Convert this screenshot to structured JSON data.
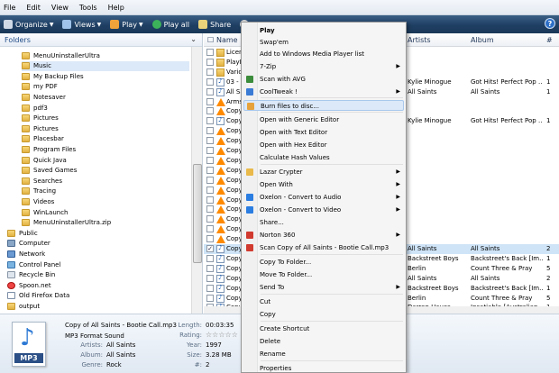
{
  "menubar": [
    "File",
    "Edit",
    "View",
    "Tools",
    "Help"
  ],
  "toolbar": {
    "organize": "Organize",
    "views": "Views",
    "play": "Play",
    "play_all": "Play all",
    "share": "Share",
    "burn": "Bu"
  },
  "folders": {
    "header": "Folders",
    "items": [
      "MenuUninstallerUltra",
      "Music",
      "My Backup Files",
      "my PDF",
      "Notesaver",
      "pdf3",
      "Pictures",
      "Pictures",
      "Placesbar",
      "Program Files",
      "Quick Java",
      "Saved Games",
      "Searches",
      "Tracing",
      "Videos",
      "WinLaunch",
      "MenuUninstallerUltra.zip",
      "Public",
      "Computer",
      "Network",
      "Control Panel",
      "Recycle Bin",
      "Spoon.net",
      "Old Firefox Data",
      "output"
    ]
  },
  "list": {
    "columns": {
      "name": "Name",
      "artists": "Artists",
      "album": "Album",
      "track": "#"
    },
    "rows": [
      {
        "name": "Licen",
        "artists": "",
        "album": "",
        "track": ""
      },
      {
        "name": "PlayL",
        "artists": "",
        "album": "",
        "track": ""
      },
      {
        "name": "Vario",
        "artists": "",
        "album": "",
        "track": ""
      },
      {
        "name": "03 -",
        "artists": "Kylie Minogue",
        "album": "Got Hits! Perfect Pop ...",
        "track": "1"
      },
      {
        "name": "All Sa",
        "artists": "All Saints",
        "album": "All Saints",
        "track": "1"
      },
      {
        "name": "Arms",
        "artists": "",
        "album": "",
        "track": ""
      },
      {
        "name": "Copy",
        "artists": "",
        "album": "",
        "track": ""
      },
      {
        "name": "Copy",
        "artists": "Kylie Minogue",
        "album": "Got Hits! Perfect Pop ...",
        "track": "1"
      },
      {
        "name": "Copy",
        "artists": "",
        "album": "",
        "track": ""
      },
      {
        "name": "Copy",
        "artists": "",
        "album": "",
        "track": ""
      },
      {
        "name": "Copy",
        "artists": "",
        "album": "",
        "track": ""
      },
      {
        "name": "Copy",
        "artists": "",
        "album": "",
        "track": ""
      },
      {
        "name": "Copy",
        "artists": "",
        "album": "",
        "track": ""
      },
      {
        "name": "Copy",
        "artists": "",
        "album": "",
        "track": ""
      },
      {
        "name": "Copy",
        "artists": "",
        "album": "",
        "track": ""
      },
      {
        "name": "Copy",
        "artists": "",
        "album": "",
        "track": ""
      },
      {
        "name": "Copy",
        "artists": "",
        "album": "",
        "track": ""
      },
      {
        "name": "Copy",
        "artists": "",
        "album": "",
        "track": ""
      },
      {
        "name": "Copy",
        "artists": "",
        "album": "",
        "track": ""
      },
      {
        "name": "Copy",
        "artists": "",
        "album": "",
        "track": ""
      },
      {
        "name": "Copy",
        "artists": "All Saints",
        "album": "All Saints",
        "track": "2"
      },
      {
        "name": "Copy",
        "artists": "Backstreet Boys",
        "album": "Backstreet's Back [Im...",
        "track": "1"
      },
      {
        "name": "Copy",
        "artists": "Berlin",
        "album": "Count Three & Pray",
        "track": "5"
      },
      {
        "name": "Copy",
        "artists": "All Saints",
        "album": "All Saints",
        "track": "2"
      },
      {
        "name": "Copy",
        "artists": "Backstreet Boys",
        "album": "Backstreet's Back [Im...",
        "track": "1"
      },
      {
        "name": "Copy",
        "artists": "Berlin",
        "album": "Count Three & Pray",
        "track": "5"
      },
      {
        "name": "Copy",
        "artists": "Darren Hayes",
        "album": "Insatiable [Australian ...",
        "track": "1"
      },
      {
        "name": "Copy",
        "artists": "Madonna",
        "album": "The Immaculate Coll...",
        "track": "2"
      }
    ]
  },
  "context_menu": {
    "items": [
      {
        "label": "Play",
        "bold": true
      },
      {
        "label": "Swap'em"
      },
      {
        "label": "Add to Windows Media Player list"
      },
      {
        "label": "7-Zip",
        "sub": true
      },
      {
        "label": "Scan with AVG"
      },
      {
        "label": "CoolTweak !",
        "sub": true
      },
      {
        "label": "Burn files to disc...",
        "highlight": true
      },
      {
        "label": "Open with Generic Editor"
      },
      {
        "label": "Open with Text Editor"
      },
      {
        "label": "Open with Hex Editor"
      },
      {
        "label": "Calculate Hash Values"
      },
      {
        "label": "Lazar Crypter",
        "sub": true
      },
      {
        "label": "Open With",
        "sub": true
      },
      {
        "label": "Oxelon - Convert to Audio",
        "sub": true
      },
      {
        "label": "Oxelon - Convert to Video",
        "sub": true
      },
      {
        "label": "Share..."
      },
      {
        "label": "Norton 360",
        "sub": true
      },
      {
        "label": "Scan Copy of All Saints - Bootie Call.mp3"
      },
      {
        "label": "Copy To Folder..."
      },
      {
        "label": "Move To Folder..."
      },
      {
        "label": "Send To",
        "sub": true
      },
      {
        "label": "Cut"
      },
      {
        "label": "Copy"
      },
      {
        "label": "Create Shortcut"
      },
      {
        "label": "Delete"
      },
      {
        "label": "Rename"
      },
      {
        "label": "Properties"
      }
    ]
  },
  "details": {
    "filename": "Copy of All Saints - Bootie Call.mp3",
    "filetype": "MP3 Format Sound",
    "icon_label": "MP3",
    "artists_label": "Artists:",
    "artists": "All Saints",
    "album_label": "Album:",
    "album": "All Saints",
    "genre_label": "Genre:",
    "genre": "Rock",
    "length_label": "Length:",
    "length": "00:03:35",
    "rating_label": "Rating:",
    "rating": "☆☆☆☆☆",
    "year_label": "Year:",
    "year": "1997",
    "size_label": "Size:",
    "size": "3.28 MB",
    "track_label": "#:",
    "track": "2"
  }
}
